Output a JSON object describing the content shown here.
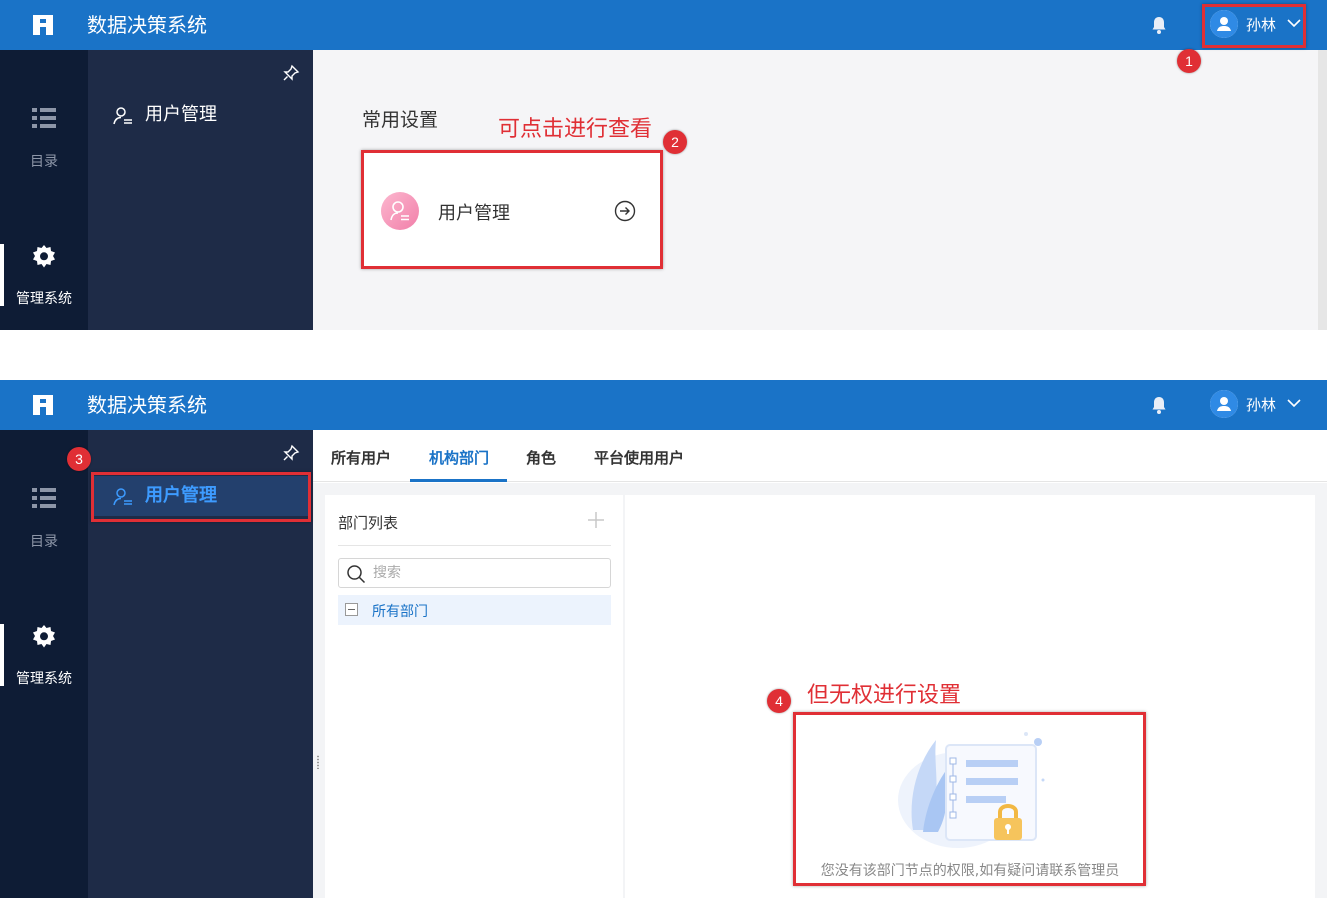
{
  "app": {
    "title": "数据决策系统"
  },
  "user": {
    "name": "孙林"
  },
  "rail": {
    "catalog_label": "目录",
    "admin_label": "管理系统"
  },
  "subnav": {
    "user_mgmt_label": "用户管理"
  },
  "top_panel": {
    "section_title": "常用设置",
    "card_label": "用户管理"
  },
  "bottom_panel": {
    "tabs": [
      "所有用户",
      "机构部门",
      "角色",
      "平台使用用户"
    ],
    "active_tab": "机构部门",
    "dept_list_title": "部门列表",
    "search_placeholder": "搜索",
    "tree_root": "所有部门",
    "no_permission_message": "您没有该部门节点的权限,如有疑问请联系管理员"
  },
  "annotations": {
    "badge_1": "1",
    "badge_2": "2",
    "badge_3": "3",
    "badge_4": "4",
    "note_2": "可点击进行查看",
    "note_4": "但无权进行设置"
  },
  "colors": {
    "header_blue": "#1a73c7",
    "rail_dark": "#0e1c35",
    "subnav_dark": "#1e2b47",
    "annotation_red": "#e02f35",
    "active_link_blue": "#3d9bff"
  }
}
